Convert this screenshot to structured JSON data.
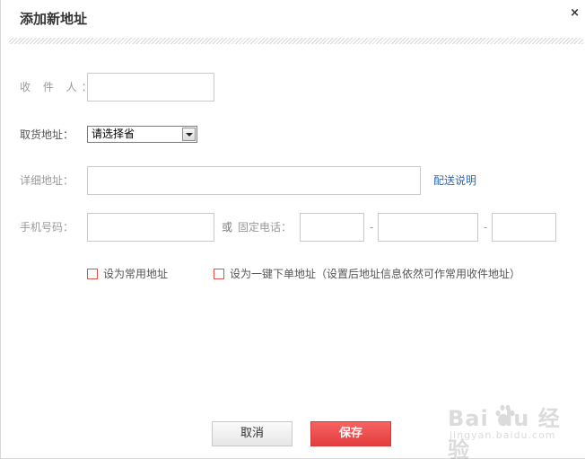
{
  "dialog": {
    "title": "添加新地址",
    "close_glyph": "×"
  },
  "form": {
    "recipient": {
      "label": "收 件 人：",
      "value": ""
    },
    "pickup": {
      "label": "取货地址：",
      "selected": "请选择省"
    },
    "detail": {
      "label": "详细地址：",
      "value": "",
      "link": "配送说明"
    },
    "mobile": {
      "label": "手机号码：",
      "value": ""
    },
    "phone": {
      "or": "或",
      "label": "固定电话：",
      "dash1": "-",
      "dash2": "-",
      "area": "",
      "number": "",
      "ext": ""
    },
    "checkbox_default": {
      "label": "设为常用地址",
      "checked": false
    },
    "checkbox_oneclick": {
      "label": "设为一键下单地址（设置后地址信息依然可作常用收件地址）",
      "checked": false
    }
  },
  "buttons": {
    "cancel": "取消",
    "save": "保存"
  },
  "colors": {
    "save_button": "#e84444",
    "link": "#2a6bb5",
    "checkbox_border": "#d9534f"
  },
  "icons": {
    "close": "close-icon",
    "dropdown": "chevron-down-icon"
  },
  "watermark": {
    "main": "Bai du 经验",
    "sub": "jingyan.baidu.com"
  }
}
